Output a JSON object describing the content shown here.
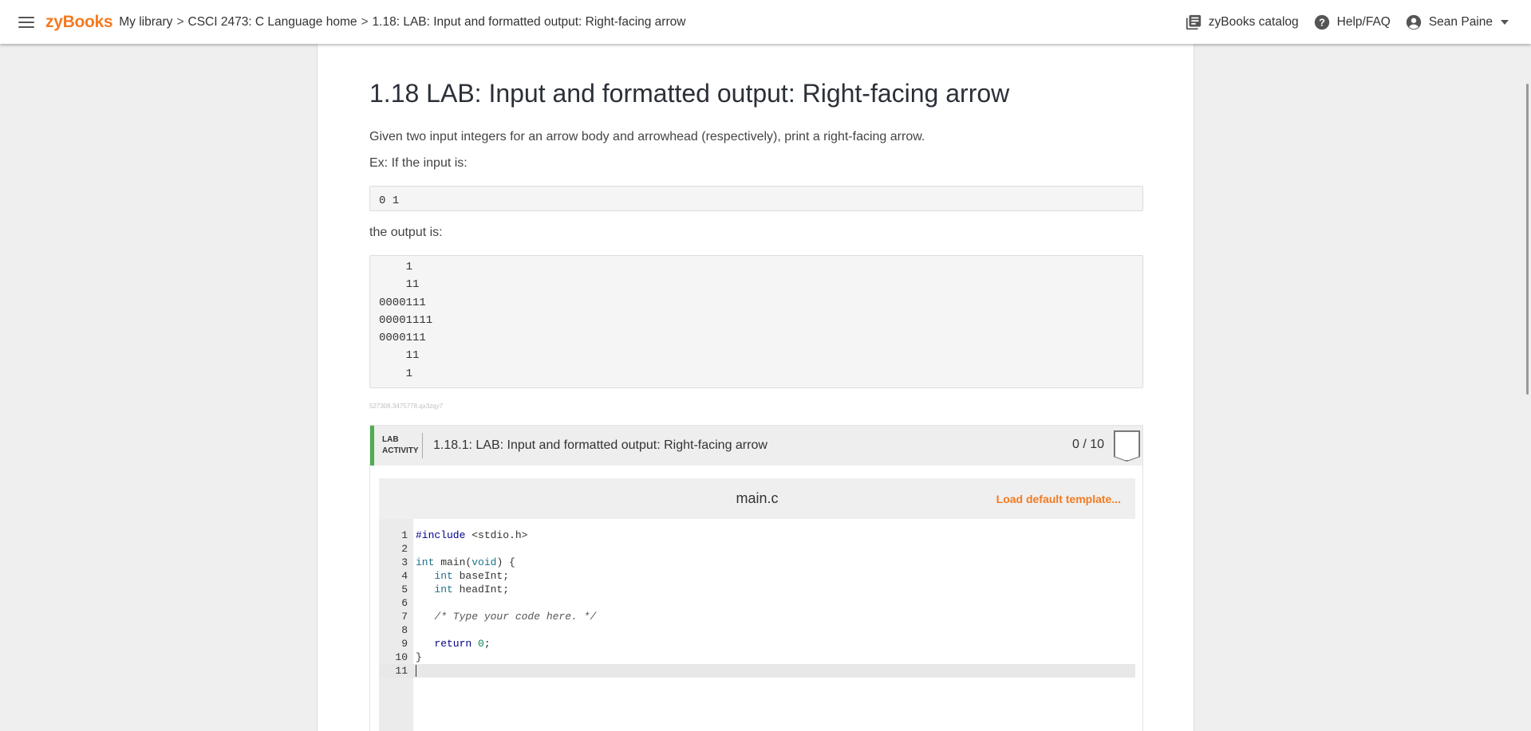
{
  "topbar": {
    "logo": "zyBooks",
    "breadcrumbs": [
      "My library",
      "CSCI 2473: C Language home",
      "1.18: LAB: Input and formatted output: Right-facing arrow"
    ],
    "separator": ">",
    "catalog_label": "zyBooks catalog",
    "help_label": "Help/FAQ",
    "user_name": "Sean Paine"
  },
  "section": {
    "title": "1.18 LAB: Input and formatted output: Right-facing arrow",
    "intro": "Given two input integers for an arrow body and arrowhead (respectively), print a right-facing arrow.",
    "example_label": "Ex: If the input is:",
    "example_input": "0 1",
    "output_label": "the output is:",
    "example_output": "    1\n    11\n0000111\n00001111\n0000111\n    11\n    1",
    "resource_id": "527306.3475778.qx3zqy7"
  },
  "lab": {
    "tag_line1": "LAB",
    "tag_line2": "ACTIVITY",
    "title": "1.18.1: LAB: Input and formatted output: Right-facing arrow",
    "score": "0 / 10",
    "file_name": "main.c",
    "load_default": "Load default template...",
    "code_lines": [
      "#include <stdio.h>",
      "",
      "int main(void) {",
      "   int baseInt;",
      "   int headInt;",
      "",
      "   /* Type your code here. */",
      "",
      "   return 0;",
      "}",
      ""
    ]
  },
  "colors": {
    "brand": "#f47a20",
    "lab_accent": "#4caf50"
  }
}
